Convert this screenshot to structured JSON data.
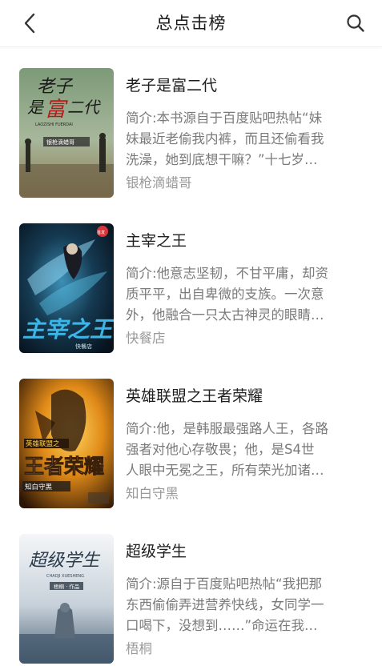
{
  "header": {
    "title": "总点击榜",
    "back_icon": "chevron-left-icon",
    "search_icon": "search-icon"
  },
  "books": [
    {
      "title": "老子是富二代",
      "desc_lines": [
        "简介:本书源自于百度贴吧热帖“妹",
        "妹最近老偷我内裤，而且还偷看我",
        "洗澡，她到底想干嘛？”十七岁…"
      ],
      "author": "银枪滴蜡哥",
      "cover_title": "老子是富二代",
      "cover_author": "银枪滴蜡哥",
      "cover_sub": "LAOZISHI FUERDAI",
      "cover_colors": {
        "top": "#6f8f6b",
        "bottom": "#9c8b5c"
      }
    },
    {
      "title": "主宰之王",
      "desc_lines": [
        "简介:他意志坚韧，不甘平庸，却资",
        "质平平，出自卑微的支族。一次意",
        "外，他融合一只太古神灵的眼睛…"
      ],
      "author": "快餐店",
      "cover_title": "主宰之王",
      "cover_author": "快餐店",
      "cover_badge": "首发",
      "cover_colors": {
        "top": "#0f2a3c",
        "bottom": "#0a1b2a"
      }
    },
    {
      "title": "英雄联盟之王者荣耀",
      "desc_lines": [
        "简介:他，是韩服最强路人王，各路",
        "强者对他心存敬畏；他，是S4世",
        "人眼中无冕之王，所有荣光加诸…"
      ],
      "author": "知白守黑",
      "cover_title": "王者荣耀",
      "cover_tag": "英雄联盟之",
      "cover_author": "知白守黑",
      "cover_colors": {
        "top": "#3a1f0a",
        "bottom": "#f0a020"
      }
    },
    {
      "title": "超级学生",
      "desc_lines": [
        "简介:源自于百度贴吧热帖“我把那",
        "东西偷偷弄进营养快线，女同学一",
        "口喝下，没想到……”命运在我…"
      ],
      "author": "梧桐",
      "cover_title": "超级学生",
      "cover_sub": "CHAOJI XUESHENG",
      "cover_author": "梧桐 · 作品",
      "cover_colors": {
        "top": "#eef2f5",
        "bottom": "#5a6f82"
      }
    }
  ],
  "colors": {
    "title": "#1e1e1e",
    "desc": "#7a7a7a",
    "author": "#9a9a9a",
    "background": "#ffffff"
  }
}
